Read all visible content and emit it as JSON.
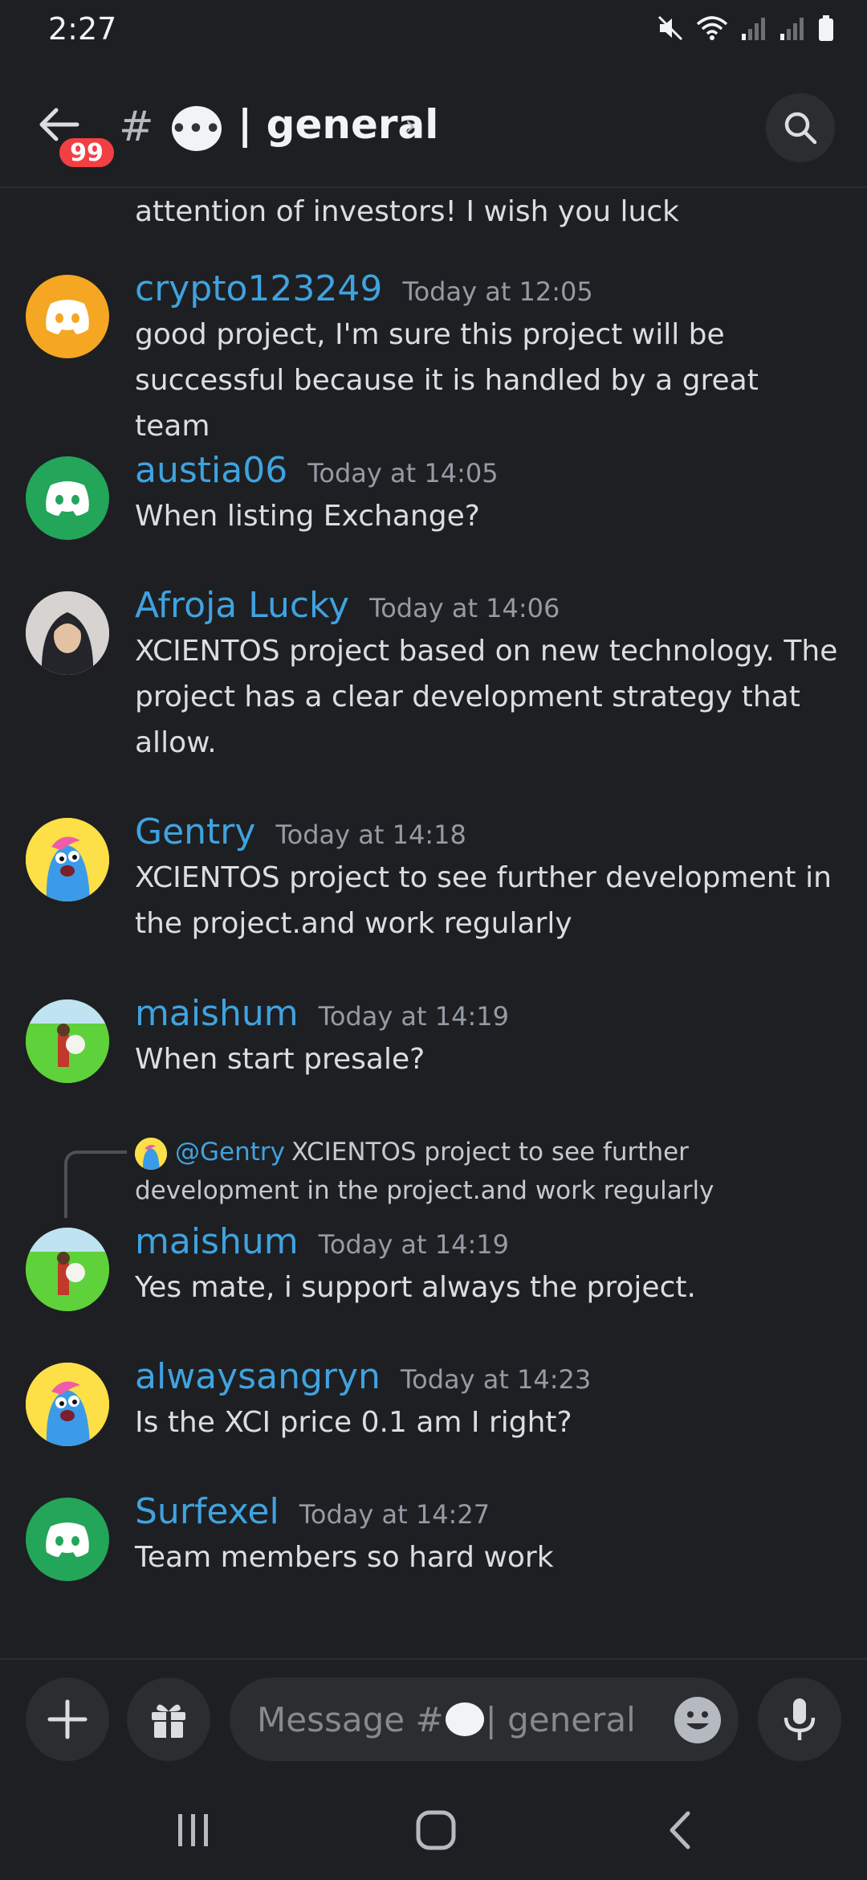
{
  "status_bar": {
    "time": "2:27"
  },
  "header": {
    "badge_count": "99",
    "hash": "#",
    "emoji_glyph": "•••",
    "channel_name": "| general",
    "chevron": "›"
  },
  "messages": {
    "cut_off_text": "attention of investors! I wish you luck",
    "items": [
      {
        "username": "crypto123249",
        "time": "Today at 12:05",
        "text": "good project, I'm sure this project will be successful because it is handled by a great team"
      },
      {
        "username": "austia06",
        "time": "Today at 14:05",
        "text": "When listing Exchange?"
      },
      {
        "username": "Afroja Lucky",
        "time": "Today at 14:06",
        "text": "XCIENTOS project based on new technology. The project has a clear development strategy that allow."
      },
      {
        "username": "Gentry",
        "time": "Today at 14:18",
        "text": "XCIENTOS project to see further development in the project.and work regularly"
      },
      {
        "username": "maishum",
        "time": "Today at 14:19",
        "text": "When start presale?"
      },
      {
        "username": "maishum",
        "time": "Today at 14:19",
        "text": "Yes mate, i support always the project."
      },
      {
        "username": "alwaysangryn",
        "time": "Today at 14:23",
        "text": "Is the XCI price 0.1 am I right?"
      },
      {
        "username": "Surfexel",
        "time": "Today at 14:27",
        "text": "Team members so hard work"
      }
    ],
    "reply": {
      "mention": "@Gentry",
      "text": "XCIENTOS project to see further development in the project.and work regularly"
    }
  },
  "composer": {
    "placeholder_prefix": "Message #",
    "placeholder_suffix": " | general"
  },
  "colors": {
    "background": "#1e1f22",
    "username": "#3fa3e0",
    "discord_orange": "#f5a623",
    "discord_green": "#23a55a",
    "badge_red": "#f23f43"
  },
  "icons": {
    "back": "arrow-left-icon",
    "search": "search-icon",
    "add": "plus-icon",
    "gift": "gift-icon",
    "emoji": "emoji-icon",
    "mic": "microphone-icon",
    "recents": "recent-apps-icon",
    "home": "home-icon",
    "nav_back": "chevron-left-icon"
  }
}
